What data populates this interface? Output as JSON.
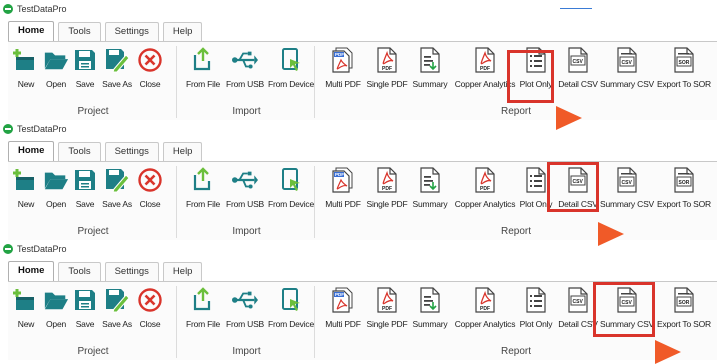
{
  "app": {
    "title": "TestDataPro"
  },
  "tabs": [
    "Home",
    "Tools",
    "Settings",
    "Help"
  ],
  "groups": {
    "project": "Project",
    "import": "Import",
    "report": "Report"
  },
  "buttons": {
    "new": "New",
    "open": "Open",
    "save": "Save",
    "save_as": "Save As",
    "close": "Close",
    "from_file": "From File",
    "from_usb": "From USB",
    "from_device": "From Device",
    "multi_pdf": "Multi PDF",
    "single_pdf": "Single PDF",
    "summary": "Summary",
    "copper_analytics": "Copper Analytics",
    "plot_only": "Plot Only",
    "detail_csv": "Detail CSV",
    "summary_csv": "Summary CSV",
    "export_to_sor": "Export To SOR"
  },
  "icon_text": {
    "pdf": "PDF",
    "csv": "CSV",
    "sor": "SOR"
  },
  "highlighted": [
    "plot_only",
    "detail_csv",
    "summary_csv"
  ],
  "colors": {
    "accent_teal": "#1e7f86",
    "pdf_red": "#d9342b",
    "highlight_border": "#d9342b",
    "pointer_arrow": "#f05a28",
    "app_icon": "#22a344"
  }
}
